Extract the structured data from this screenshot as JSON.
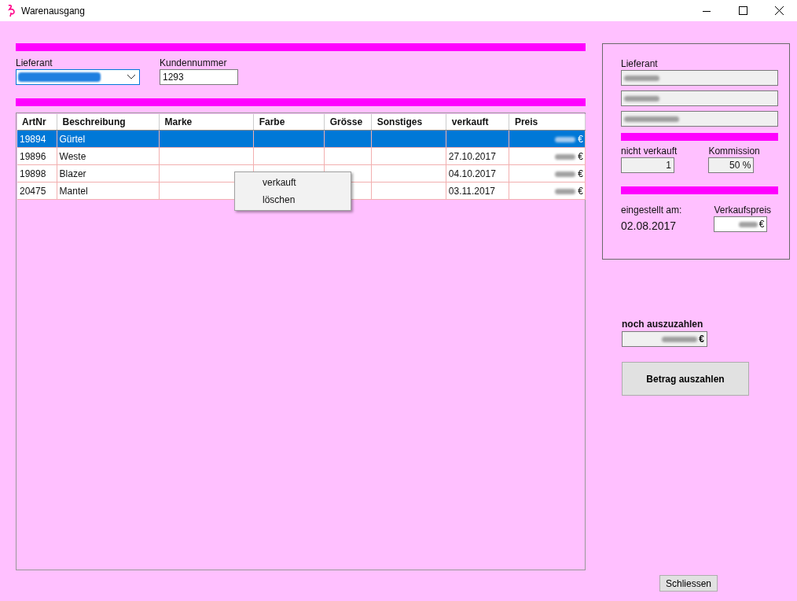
{
  "window": {
    "title": "Warenausgang"
  },
  "header": {
    "supplier_label": "Lieferant",
    "supplier_combo": {
      "blurred": true
    },
    "customer_number_label": "Kundennummer",
    "customer_number": "1293"
  },
  "table": {
    "columns": [
      "ArtNr",
      "Beschreibung",
      "Marke",
      "Farbe",
      "Grösse",
      "Sonstiges",
      "verkauft",
      "Preis"
    ],
    "rows": [
      {
        "art_nr": "19894",
        "description": "Gürtel",
        "price": "€",
        "price_blurred": true,
        "selected": true
      },
      {
        "art_nr": "19896",
        "description": "Weste",
        "sold_date": "27.10.2017",
        "price": "€",
        "price_blurred": true,
        "selected": false
      },
      {
        "art_nr": "19898",
        "description": "Blazer",
        "sold_date": "04.10.2017",
        "price": "€",
        "price_blurred": true,
        "selected": false
      },
      {
        "art_nr": "20475",
        "description": "Mantel",
        "sold_date": "03.11.2017",
        "price": "€",
        "price_blurred": true,
        "selected": false
      }
    ]
  },
  "context_menu": {
    "items": [
      {
        "label": "verkauft"
      },
      {
        "label": "löschen"
      }
    ]
  },
  "details": {
    "supplier_label": "Lieferant",
    "supplier_fields": [
      {
        "blurred": true
      },
      {
        "blurred": true
      },
      {
        "blurred": true
      }
    ],
    "not_sold_label": "nicht verkauft",
    "not_sold": "1",
    "commission_label": "Kommission",
    "commission": "50 %",
    "listed_label": "eingestellt am:",
    "listed_date": "02.08.2017",
    "sale_price_label": "Verkaufspreis",
    "sale_price": "€",
    "sale_price_blurred": true
  },
  "payout": {
    "label": "noch auszuzahlen",
    "amount": "€",
    "amount_blurred": true,
    "button": "Betrag auszahlen"
  },
  "close_button": "Schliessen"
}
